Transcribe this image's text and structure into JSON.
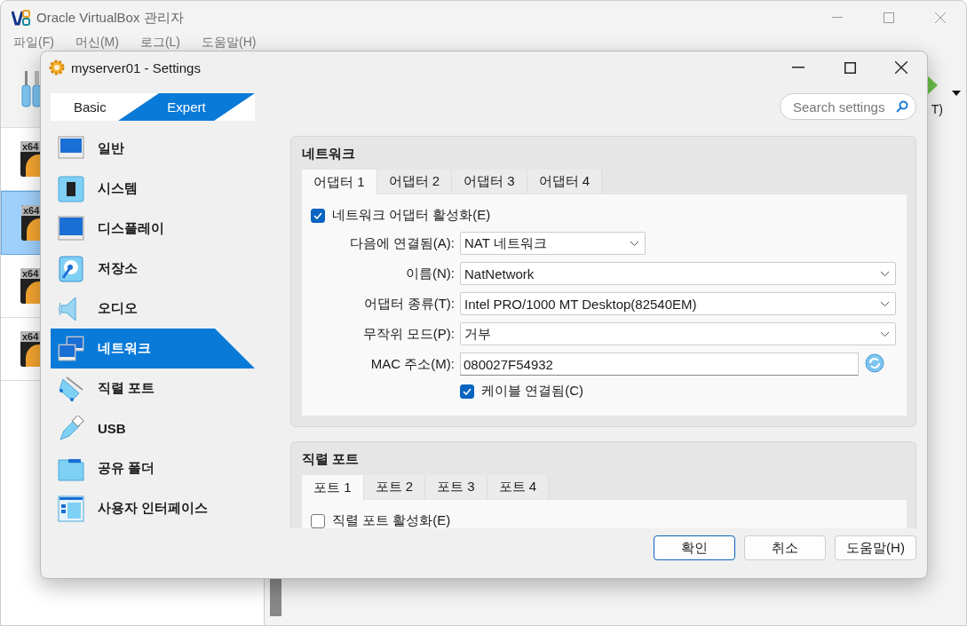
{
  "main_window": {
    "title": "Oracle VirtualBox 관리자",
    "menu": [
      "파일(F)",
      "머신(M)",
      "로그(L)",
      "도움말(H)"
    ],
    "vm_list": [
      {
        "badge": "x64",
        "selected": false
      },
      {
        "badge": "x64",
        "selected": true
      },
      {
        "badge": "x64",
        "selected": false
      },
      {
        "badge": "x64",
        "selected": false
      }
    ],
    "toolbar_label": "T)"
  },
  "dialog": {
    "title": "myserver01 - Settings",
    "modes": [
      {
        "label": "Basic",
        "selected": false
      },
      {
        "label": "Expert",
        "selected": true
      }
    ],
    "search": {
      "placeholder": "Search settings"
    },
    "categories": [
      {
        "label": "일반",
        "kind": "general",
        "selected": false
      },
      {
        "label": "시스템",
        "kind": "system",
        "selected": false
      },
      {
        "label": "디스플레이",
        "kind": "display",
        "selected": false
      },
      {
        "label": "저장소",
        "kind": "storage",
        "selected": false
      },
      {
        "label": "오디오",
        "kind": "audio",
        "selected": false
      },
      {
        "label": "네트워크",
        "kind": "network",
        "selected": true
      },
      {
        "label": "직렬 포트",
        "kind": "serial",
        "selected": false
      },
      {
        "label": "USB",
        "kind": "usb",
        "selected": false
      },
      {
        "label": "공유 폴더",
        "kind": "folder",
        "selected": false
      },
      {
        "label": "사용자 인터페이스",
        "kind": "ui",
        "selected": false
      }
    ],
    "network": {
      "title": "네트워크",
      "tabs": [
        {
          "label": "어댑터 1",
          "selected": true
        },
        {
          "label": "어댑터 2",
          "selected": false
        },
        {
          "label": "어댑터 3",
          "selected": false
        },
        {
          "label": "어댑터 4",
          "selected": false
        }
      ],
      "enable": {
        "label": "네트워크 어댑터 활성화(E)",
        "checked": true
      },
      "fields": [
        {
          "label": "다음에 연결됨(A):",
          "value": "NAT 네트워크",
          "kind": "short-dropdown"
        },
        {
          "label": "이름(N):",
          "value": "NatNetwork",
          "kind": "dropdown"
        },
        {
          "label": "어댑터 종류(T):",
          "value": "Intel PRO/1000 MT Desktop(82540EM)",
          "kind": "dropdown"
        },
        {
          "label": "무작위 모드(P):",
          "value": "거부",
          "kind": "dropdown"
        },
        {
          "label": "MAC 주소(M):",
          "value": "080027F54932",
          "kind": "text"
        }
      ],
      "cable": {
        "label": "케이블 연결됨(C)",
        "checked": true
      }
    },
    "serial": {
      "title": "직렬 포트",
      "tabs": [
        {
          "label": "포트 1",
          "selected": true
        },
        {
          "label": "포트 2",
          "selected": false
        },
        {
          "label": "포트 3",
          "selected": false
        },
        {
          "label": "포트 4",
          "selected": false
        }
      ],
      "enable": {
        "label": "직렬 포트 활성화(E)",
        "checked": false
      }
    },
    "buttons": [
      {
        "label": "확인",
        "default": true
      },
      {
        "label": "취소",
        "default": false
      },
      {
        "label": "도움말(H)",
        "default": false
      }
    ]
  }
}
